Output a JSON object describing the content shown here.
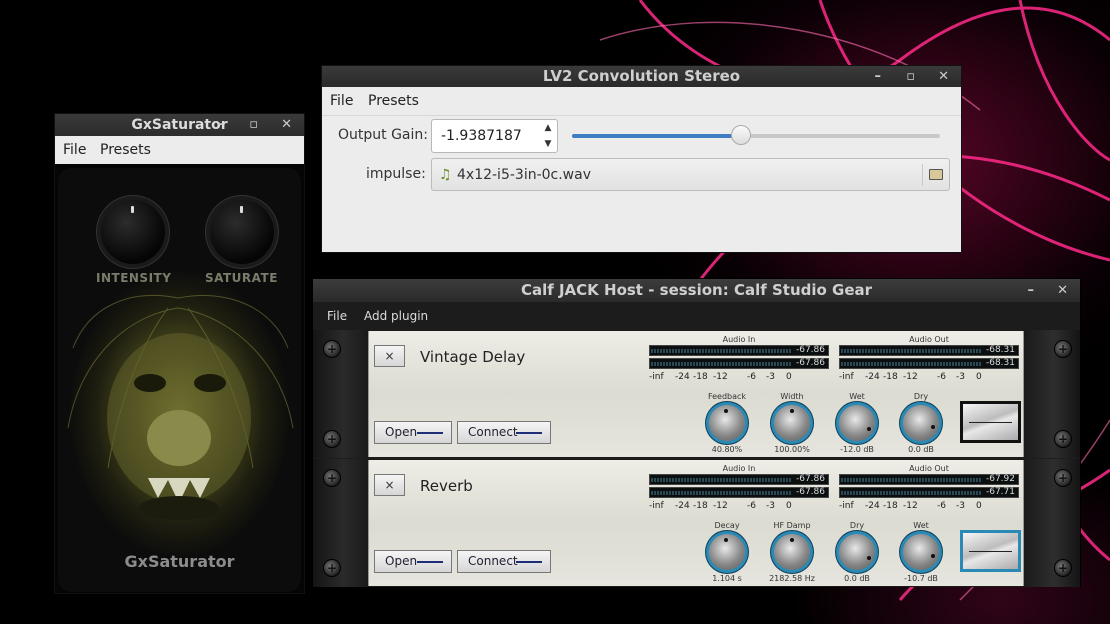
{
  "colors": {
    "accent": "#3f7ec1",
    "knob_ring": "#2a8ab5",
    "bg_streak": "#ff2a8a"
  },
  "gx": {
    "title": "GxSaturator",
    "menu": [
      "File",
      "Presets"
    ],
    "knob1": "INTENSITY",
    "knob2": "SATURATE",
    "name": "GxSaturator",
    "controls": {
      "min": "–",
      "max": "▫",
      "close": "✕"
    }
  },
  "lv2": {
    "title": "LV2 Convolution Stereo",
    "menu": [
      "File",
      "Presets"
    ],
    "gain_label": "Output Gain:",
    "gain_value": "-1.9387187",
    "gain_level": 0.46,
    "impulse_label": "impulse:",
    "impulse_file": "4x12-i5-3in-0c.wav",
    "icons": {
      "file": "music-note-icon",
      "browse": "folder-icon"
    },
    "controls": {
      "min": "–",
      "max": "▫",
      "close": "✕"
    }
  },
  "calf": {
    "title": "Calf JACK Host - session: Calf Studio Gear",
    "menu": [
      "File",
      "Add plugin"
    ],
    "controls": {
      "min": "–",
      "close": "✕"
    },
    "scale": [
      "-inf",
      "-24",
      "-18",
      "-12",
      "-6",
      "-3",
      "0"
    ],
    "plugins": [
      {
        "remove": "×",
        "name": "Vintage Delay",
        "open": "Open",
        "connect": "Connect",
        "in_label": "Audio In",
        "out_label": "Audio Out",
        "in": [
          "-67.86",
          "-67.86"
        ],
        "out": [
          "-68.31",
          "-68.31"
        ],
        "knobs": [
          {
            "name": "Feedback",
            "value": "40.80%"
          },
          {
            "name": "Width",
            "value": "100.00%"
          },
          {
            "name": "Wet",
            "value": "-12.0 dB"
          },
          {
            "name": "Dry",
            "value": "0.0 dB"
          }
        ]
      },
      {
        "remove": "×",
        "name": "Reverb",
        "open": "Open",
        "connect": "Connect",
        "in_label": "Audio In",
        "out_label": "Audio Out",
        "in": [
          "-67.86",
          "-67.86"
        ],
        "out": [
          "-67.92",
          "-67.71"
        ],
        "knobs": [
          {
            "name": "Decay",
            "value": "1.104 s"
          },
          {
            "name": "HF Damp",
            "value": "2182.58 Hz"
          },
          {
            "name": "Dry",
            "value": "0.0 dB"
          },
          {
            "name": "Wet",
            "value": "-10.7 dB"
          }
        ]
      }
    ]
  }
}
